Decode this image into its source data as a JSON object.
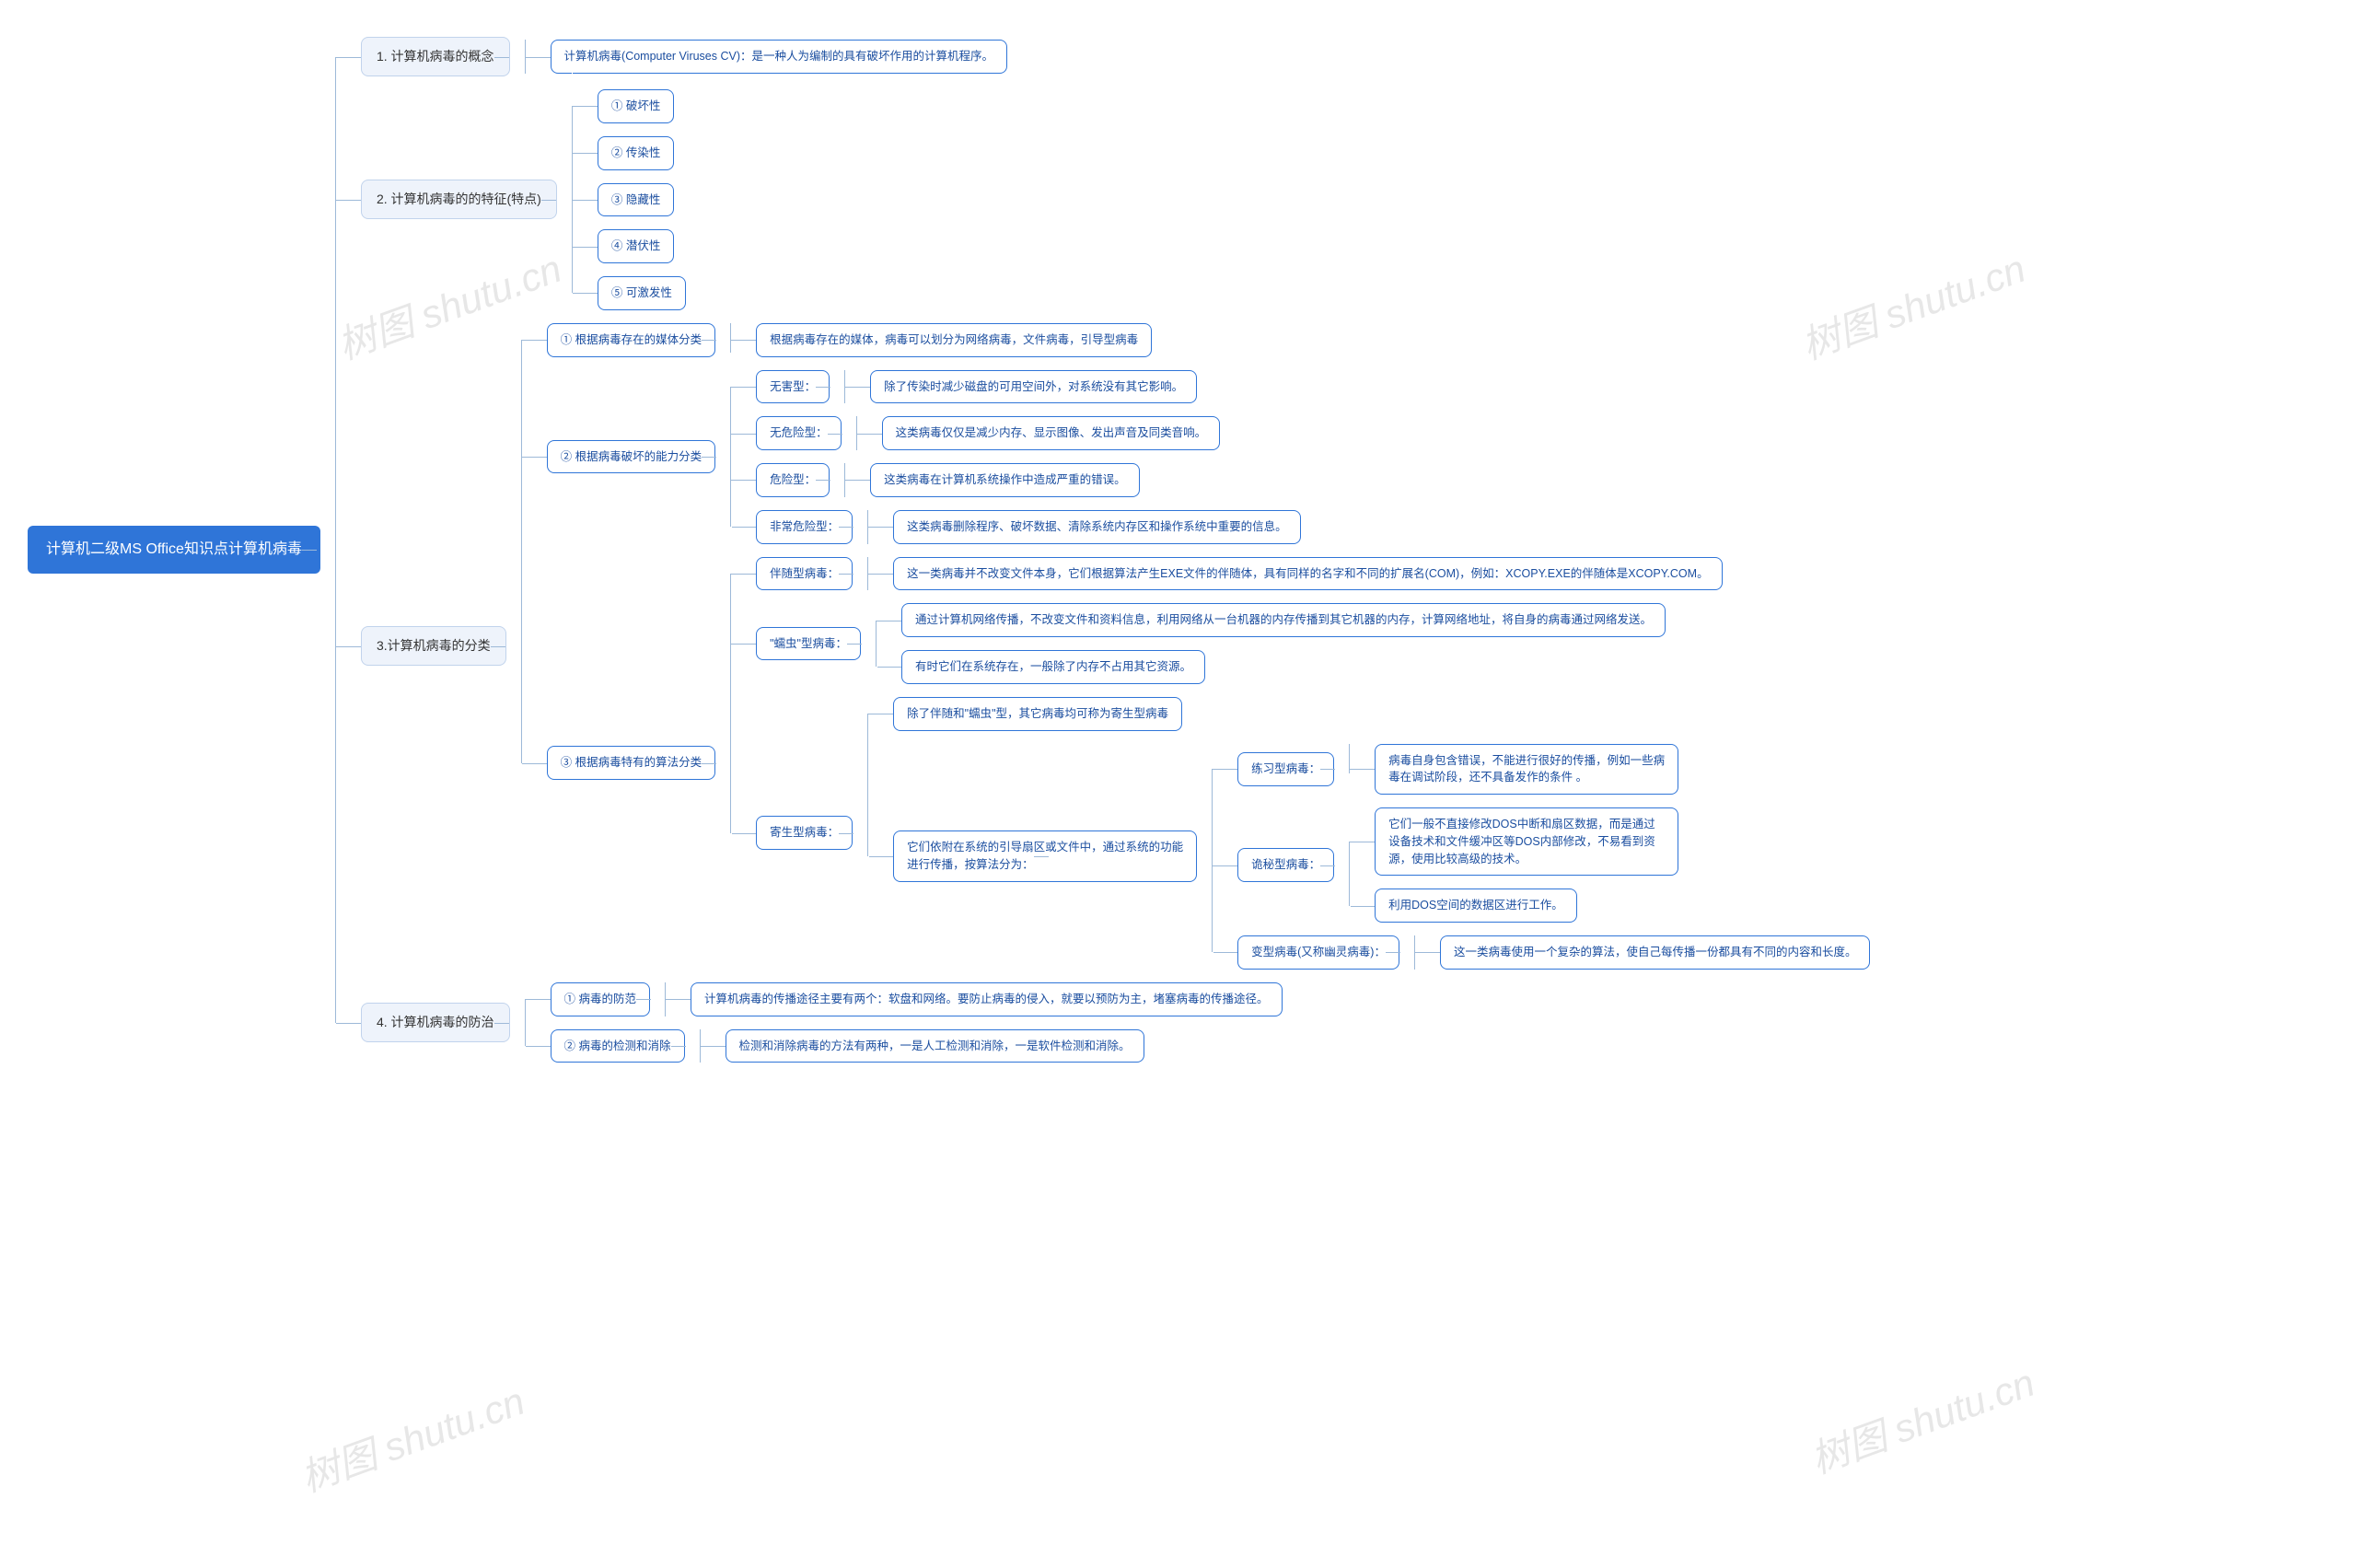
{
  "watermark": "树图 shutu.cn",
  "root": "计算机二级MS Office知识点计算机病毒",
  "s1": {
    "title": "1. 计算机病毒的概念",
    "def": "计算机病毒(Computer Viruses CV)：是一种人为编制的具有破坏作用的计算机程序。"
  },
  "s2": {
    "title": "2. 计算机病毒的的特征(特点)",
    "items": [
      "① 破坏性",
      "② 传染性",
      "③ 隐藏性",
      "④ 潜伏性",
      "⑤ 可激发性"
    ]
  },
  "s3": {
    "title": "3.计算机病毒的分类",
    "c1": {
      "label": "① 根据病毒存在的媒体分类",
      "desc": "根据病毒存在的媒体，病毒可以划分为网络病毒，文件病毒，引导型病毒"
    },
    "c2": {
      "label": "② 根据病毒破坏的能力分类",
      "rows": [
        {
          "k": "无害型：",
          "v": "除了传染时减少磁盘的可用空间外，对系统没有其它影响。"
        },
        {
          "k": "无危险型：",
          "v": "这类病毒仅仅是减少内存、显示图像、发出声音及同类音响。"
        },
        {
          "k": "危险型：",
          "v": "这类病毒在计算机系统操作中造成严重的错误。"
        },
        {
          "k": "非常危险型：",
          "v": "这类病毒删除程序、破坏数据、清除系统内存区和操作系统中重要的信息。"
        }
      ]
    },
    "c3": {
      "label": "③ 根据病毒特有的算法分类",
      "companion": {
        "k": "伴随型病毒：",
        "v": "这一类病毒并不改变文件本身，它们根据算法产生EXE文件的伴随体，具有同样的名字和不同的扩展名(COM)，例如：XCOPY.EXE的伴随体是XCOPY.COM。"
      },
      "worm": {
        "k": "\"蠕虫\"型病毒：",
        "v1": "通过计算机网络传播，不改变文件和资料信息，利用网络从一台机器的内存传播到其它机器的内存，计算网络地址，将自身的病毒通过网络发送。",
        "v2": "有时它们在系统存在，一般除了内存不占用其它资源。"
      },
      "parasite": {
        "k": "寄生型病毒：",
        "v1": "除了伴随和\"蠕虫\"型，其它病毒均可称为寄生型病毒",
        "v2": "它们依附在系统的引导扇区或文件中，通过系统的功能进行传播，按算法分为：",
        "practice": {
          "k": "练习型病毒：",
          "v": "病毒自身包含错误，不能进行很好的传播，例如一些病毒在调试阶段，还不具备发作的条件 。"
        },
        "stealth": {
          "k": "诡秘型病毒：",
          "v1": "它们一般不直接修改DOS中断和扇区数据，而是通过设备技术和文件缓冲区等DOS内部修改，不易看到资源，使用比较高级的技术。",
          "v2": "利用DOS空间的数据区进行工作。"
        },
        "poly": {
          "k": "变型病毒(又称幽灵病毒)：",
          "v": "这一类病毒使用一个复杂的算法，使自己每传播一份都具有不同的内容和长度。"
        }
      }
    }
  },
  "s4": {
    "title": "4. 计算机病毒的防治",
    "a": {
      "k": "① 病毒的防范",
      "v": "计算机病毒的传播途径主要有两个：软盘和网络。要防止病毒的侵入，就要以预防为主，堵塞病毒的传播途径。"
    },
    "b": {
      "k": "② 病毒的检测和消除",
      "v": "检测和消除病毒的方法有两种，一是人工检测和消除，一是软件检测和消除。"
    }
  }
}
